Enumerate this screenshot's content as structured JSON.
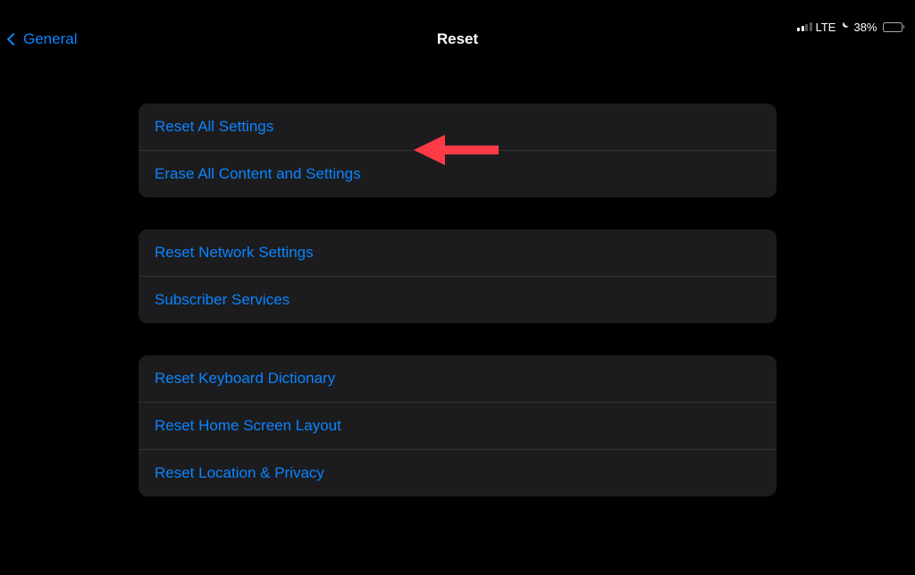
{
  "statusBar": {
    "network": "LTE",
    "batteryPercent": "38%",
    "batteryFill": 38
  },
  "nav": {
    "backLabel": "General",
    "title": "Reset"
  },
  "groups": [
    {
      "rows": [
        "Reset All Settings",
        "Erase All Content and Settings"
      ]
    },
    {
      "rows": [
        "Reset Network Settings",
        "Subscriber Services"
      ]
    },
    {
      "rows": [
        "Reset Keyboard Dictionary",
        "Reset Home Screen Layout",
        "Reset Location & Privacy"
      ]
    }
  ],
  "annotation": {
    "arrowColor": "#ff3a47"
  }
}
